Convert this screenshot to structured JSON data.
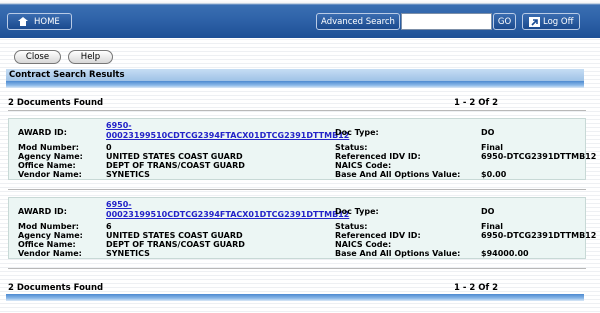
{
  "topbar": {
    "home_label": "HOME",
    "advanced_search_label": "Advanced Search",
    "search_value": "",
    "go_label": "GO",
    "logoff_label": "Log Off"
  },
  "actions": {
    "close_label": "Close",
    "help_label": "Help"
  },
  "results_header": "Contract Search Results",
  "summary": {
    "count_text": "2 Documents Found",
    "range_text": "1 - 2  Of 2"
  },
  "labels": {
    "award_id": "AWARD ID:",
    "mod_number": "Mod Number:",
    "agency_name": "Agency Name:",
    "office_name": "Office Name:",
    "vendor_name": "Vendor Name:",
    "doc_type": "Doc Type:",
    "status": "Status:",
    "ref_idv_id": "Referenced IDV ID:",
    "naics_code": "NAICS Code:",
    "base_value": "Base And All Options Value:"
  },
  "records": [
    {
      "award_id_line1": "6950-",
      "award_id_line2": "00023199510CDTCG2394FTACX01DTCG2391DTTMB12",
      "mod_number": "0",
      "agency_name": "UNITED STATES COAST GUARD",
      "office_name": "DEPT OF TRANS/COAST GUARD",
      "vendor_name": "SYNETICS",
      "doc_type": "DO",
      "status": "Final",
      "ref_idv_id": "6950-DTCG2391DTTMB12",
      "naics_code": "",
      "base_value": "$0.00"
    },
    {
      "award_id_line1": "6950-",
      "award_id_line2": "00023199510CDTCG2394FTACX01DTCG2391DTTMB12",
      "mod_number": "6",
      "agency_name": "UNITED STATES COAST GUARD",
      "office_name": "DEPT OF TRANS/COAST GUARD",
      "vendor_name": "SYNETICS",
      "doc_type": "DO",
      "status": "Final",
      "ref_idv_id": "6950-DTCG2391DTTMB12",
      "naics_code": "",
      "base_value": "$94000.00"
    }
  ],
  "colors": {
    "nav_blue": "#2e62a8",
    "header_bar": "#b4d0ee",
    "record_bg": "#ecf6f4",
    "link": "#2323c8"
  }
}
